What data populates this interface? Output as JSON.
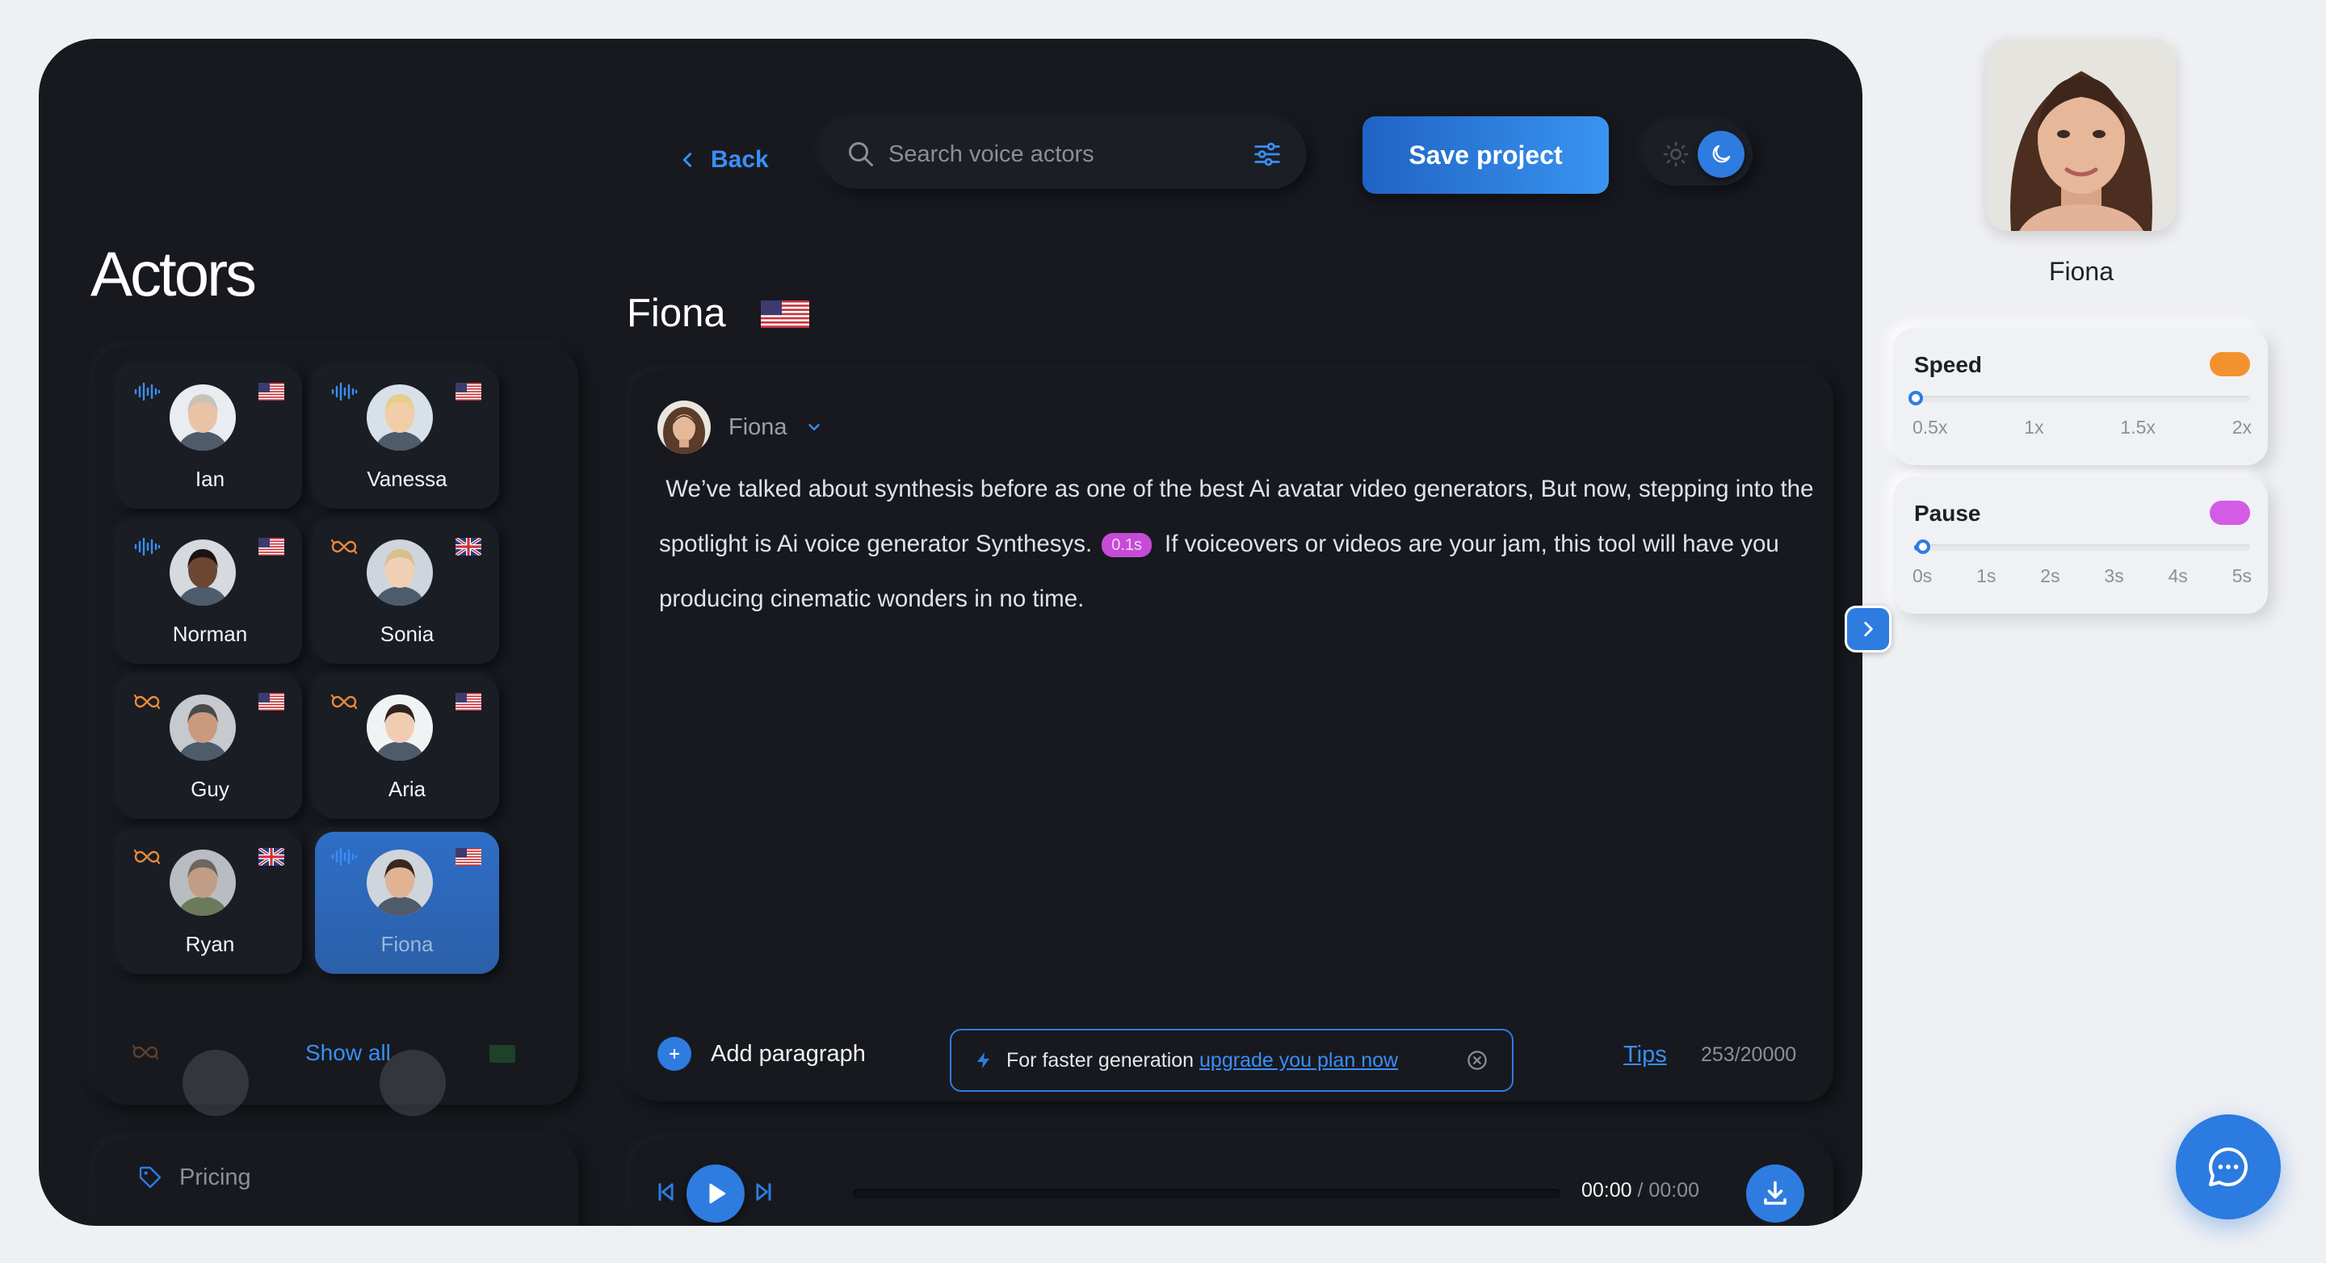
{
  "header": {
    "back_label": "Back",
    "search_placeholder": "Search voice actors",
    "save_label": "Save project"
  },
  "actors": {
    "title": "Actors",
    "items": [
      {
        "name": "Ian",
        "flag": "us",
        "kind": "waveform-icon"
      },
      {
        "name": "Vanessa",
        "flag": "us",
        "kind": "waveform-icon"
      },
      {
        "name": "Norman",
        "flag": "us",
        "kind": "waveform-icon"
      },
      {
        "name": "Sonia",
        "flag": "uk",
        "kind": "infinity-icon"
      },
      {
        "name": "Guy",
        "flag": "us",
        "kind": "infinity-icon"
      },
      {
        "name": "Aria",
        "flag": "us",
        "kind": "infinity-icon"
      },
      {
        "name": "Ryan",
        "flag": "uk",
        "kind": "infinity-icon"
      },
      {
        "name": "Fiona",
        "flag": "us",
        "kind": "waveform-icon",
        "selected": true
      }
    ],
    "show_all_label": "Show all",
    "pricing_label": "Pricing"
  },
  "editor": {
    "title": "Fiona",
    "voice_name": "Fiona",
    "text_part1": "We’ve talked about synthesis before as one of the best Ai avatar video generators, But now, stepping into the spotlight is Ai voice generator Synthesys.",
    "pause_tag": "0.1s",
    "text_part2": "If voiceovers or videos are your jam, this tool will have you producing cinematic wonders in no time.",
    "add_paragraph_label": "Add paragraph",
    "upgrade_text": "For faster generation",
    "upgrade_link": "upgrade you plan now",
    "tips_label": "Tips",
    "char_count": "253/20000"
  },
  "player": {
    "current_time": "00:00",
    "separator": "/",
    "total_time": "00:00"
  },
  "settings": {
    "profile_name": "Fiona",
    "speed": {
      "label": "Speed",
      "toggle_color": "#f2922e",
      "value": "0.5x",
      "ticks": [
        "0.5x",
        "1x",
        "1.5x",
        "2x"
      ]
    },
    "pause": {
      "label": "Pause",
      "toggle_color": "#d35be6",
      "value": "0s",
      "ticks": [
        "0s",
        "1s",
        "2s",
        "3s",
        "4s",
        "5s"
      ]
    }
  },
  "colors": {
    "accent": "#2e7ce0",
    "app_bg": "#17191f",
    "page_bg": "#eff0f3"
  }
}
